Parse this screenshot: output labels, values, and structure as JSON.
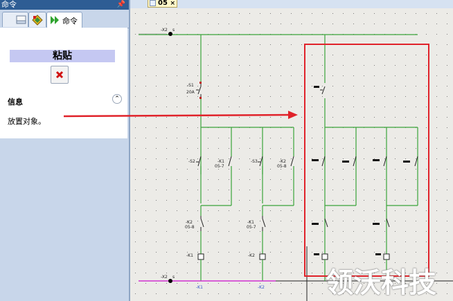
{
  "panel": {
    "title": "命令",
    "tabs": [
      {
        "label": "命令"
      }
    ],
    "paste_title": "粘贴",
    "info_title": "信息",
    "info_text": "放置对象。"
  },
  "document_tab": {
    "name": "05",
    "close": "×"
  },
  "schematic": {
    "labels": [
      {
        "text": "-X2"
      },
      {
        "text": "s"
      },
      {
        "text": "-S1"
      },
      {
        "text": "20A"
      },
      {
        "text": "-S2"
      },
      {
        "text": "-K1"
      },
      {
        "text": "05-7"
      },
      {
        "text": "-S3"
      },
      {
        "text": "-K2"
      },
      {
        "text": "05-8"
      },
      {
        "text": "-K2"
      },
      {
        "text": "05-8"
      },
      {
        "text": "-K1"
      },
      {
        "text": "05-7"
      },
      {
        "text": "-K1"
      },
      {
        "text": "-K2"
      },
      {
        "text": "-X2"
      },
      {
        "text": "s"
      },
      {
        "text": "-K1"
      },
      {
        "text": "-K2"
      }
    ]
  },
  "watermark": "领沃科技",
  "colors": {
    "title_bar": "#2e5d94",
    "wire_green": "#3aa33a",
    "wire_magenta": "#d030d0",
    "highlight_red": "#e0222a",
    "arrow_red": "#e0222a",
    "paste_bg": "#c5c8f2",
    "cancel_icon": "#d01010"
  }
}
